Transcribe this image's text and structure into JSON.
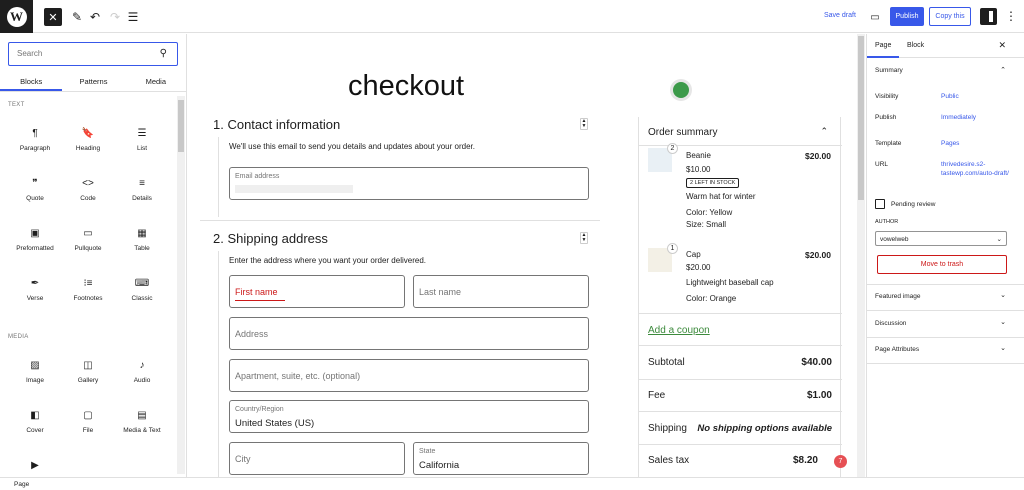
{
  "topbar": {
    "save_draft": "Save draft",
    "publish": "Publish",
    "copy_this": "Copy this"
  },
  "inserter": {
    "search_placeholder": "Search",
    "tabs": [
      "Blocks",
      "Patterns",
      "Media"
    ],
    "category_text": "TEXT",
    "category_media": "MEDIA",
    "text_blocks": [
      {
        "label": "Paragraph",
        "icon": "paragraph-icon",
        "glyph": "¶"
      },
      {
        "label": "Heading",
        "icon": "heading-icon",
        "glyph": "🔖"
      },
      {
        "label": "List",
        "icon": "list-icon",
        "glyph": "☰"
      },
      {
        "label": "Quote",
        "icon": "quote-icon",
        "glyph": "❞"
      },
      {
        "label": "Code",
        "icon": "code-icon",
        "glyph": "<>"
      },
      {
        "label": "Details",
        "icon": "details-icon",
        "glyph": "≡"
      },
      {
        "label": "Preformatted",
        "icon": "preformatted-icon",
        "glyph": "▣"
      },
      {
        "label": "Pullquote",
        "icon": "pullquote-icon",
        "glyph": "▭"
      },
      {
        "label": "Table",
        "icon": "table-icon",
        "glyph": "▦"
      },
      {
        "label": "Verse",
        "icon": "verse-icon",
        "glyph": "✒"
      },
      {
        "label": "Footnotes",
        "icon": "footnotes-icon",
        "glyph": "⁝≡"
      },
      {
        "label": "Classic",
        "icon": "classic-icon",
        "glyph": "⌨"
      }
    ],
    "media_blocks": [
      {
        "label": "Image",
        "icon": "image-icon",
        "glyph": "▨"
      },
      {
        "label": "Gallery",
        "icon": "gallery-icon",
        "glyph": "◫"
      },
      {
        "label": "Audio",
        "icon": "audio-icon",
        "glyph": "♪"
      },
      {
        "label": "Cover",
        "icon": "cover-icon",
        "glyph": "◧"
      },
      {
        "label": "File",
        "icon": "file-icon",
        "glyph": "▢"
      },
      {
        "label": "Media & Text",
        "icon": "media-text-icon",
        "glyph": "▤"
      },
      {
        "label": "",
        "icon": "video-icon",
        "glyph": "▶"
      }
    ]
  },
  "canvas": {
    "title": "checkout",
    "contact": {
      "heading": "1.  Contact information",
      "sub": "We'll use this email to send you details and updates about your order.",
      "email_label": "Email address"
    },
    "shipping": {
      "heading": "2.  Shipping address",
      "sub": "Enter the address where you want your order delivered.",
      "first_name": "First name",
      "last_name": "Last name",
      "address": "Address",
      "apartment": "Apartment, suite, etc. (optional)",
      "country_label": "Country/Region",
      "country_value": "United States (US)",
      "city": "City",
      "state_label": "State",
      "state_value": "California"
    },
    "summary": {
      "heading": "Order summary",
      "items": [
        {
          "qty": "2",
          "name": "Beanie",
          "unit_price": "$10.00",
          "stock": "2 LEFT IN STOCK",
          "desc": "Warm hat for winter",
          "attrs": [
            "Color: Yellow",
            "Size: Small"
          ],
          "total": "$20.00"
        },
        {
          "qty": "1",
          "name": "Cap",
          "unit_price": "$20.00",
          "desc": "Lightweight baseball cap",
          "attrs": [
            "Color: Orange"
          ],
          "total": "$20.00"
        }
      ],
      "coupon": "Add a coupon",
      "rows": [
        {
          "label": "Subtotal",
          "value": "$40.00"
        },
        {
          "label": "Fee",
          "value": "$1.00"
        },
        {
          "label": "Shipping",
          "value": "No shipping options available"
        },
        {
          "label": "Sales tax",
          "value": "$8.20"
        }
      ],
      "badge": "7"
    }
  },
  "sidebar": {
    "tab_page": "Page",
    "tab_block": "Block",
    "summary_title": "Summary",
    "visibility_label": "Visibility",
    "visibility_value": "Public",
    "publish_label": "Publish",
    "publish_value": "Immediately",
    "template_label": "Template",
    "template_value": "Pages",
    "url_label": "URL",
    "url_value": "thrivedesire.s2-tastewp.com/auto-draft/",
    "pending_review": "Pending review",
    "author_label": "AUTHOR",
    "author_value": "vowelweb",
    "move_to_trash": "Move to trash",
    "featured_image": "Featured image",
    "discussion": "Discussion",
    "page_attributes": "Page Attributes"
  },
  "footer": {
    "breadcrumb": "Page"
  }
}
